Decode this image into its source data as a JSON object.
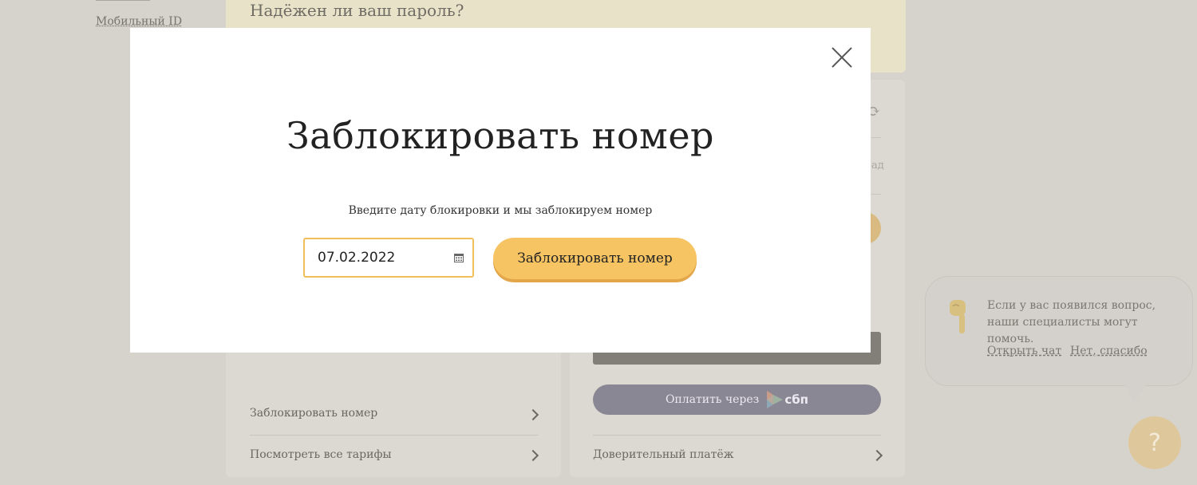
{
  "background": {
    "left_nav": {
      "mobile_id_link": "Мобильный ID"
    },
    "password_card": {
      "title": "Надёжен ли ваш пароль?"
    },
    "left_card": {
      "items": [
        {
          "label": "Заблокировать номер"
        },
        {
          "label": "Посмотреть все тарифы"
        }
      ]
    },
    "right_card": {
      "partial_text": "ад",
      "sbp_button": {
        "label": "Оплатить через",
        "logo_text": "сбп"
      },
      "trust_payment": "Доверительный платёж"
    },
    "chat_widget": {
      "message": "Если у вас появился вопрос, наши специалисты могут помочь.",
      "open_chat": "Открыть чат",
      "no_thanks": "Нет, спасибо",
      "help_symbol": "?"
    }
  },
  "modal": {
    "title": "Заблокировать номер",
    "subtitle": "Введите дату блокировки и мы заблокируем номер",
    "date_input": {
      "value": "07.02.2022",
      "icon": "calendar-icon"
    },
    "submit_label": "Заблокировать номер",
    "close_icon": "close-icon"
  },
  "colors": {
    "accent": "#f7c463",
    "field_border": "#f1be5a",
    "overlay_bg": "#d6d3cc"
  }
}
